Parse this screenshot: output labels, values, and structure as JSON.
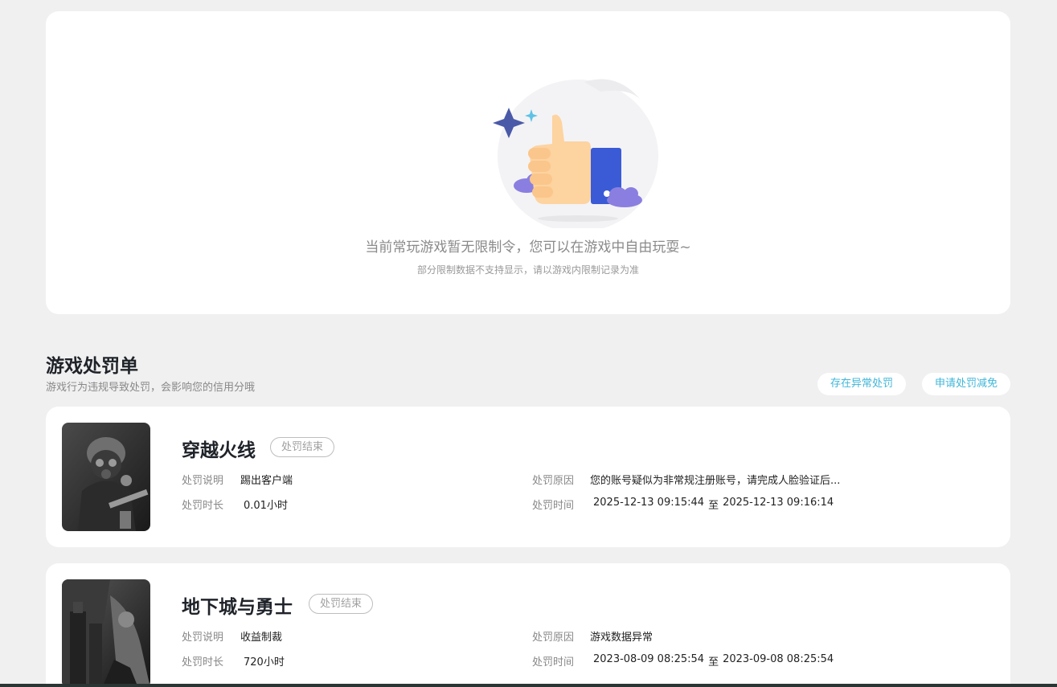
{
  "status": {
    "title": "当前常玩游戏暂无限制令，您可以在游戏中自由玩耍~",
    "note": "部分限制数据不支持显示，请以游戏内限制记录为准"
  },
  "section": {
    "title": "游戏处罚单",
    "subtitle": "游戏行为违规导致处罚，会影响您的信用分哦",
    "buttons": {
      "abnormal": "存在异常处罚",
      "reduce": "申请处罚减免"
    }
  },
  "labels": {
    "desc": "处罚说明",
    "duration": "处罚时长",
    "reason": "处罚原因",
    "time": "处罚时间",
    "to": "至"
  },
  "penalties": [
    {
      "game": "穿越火线",
      "status": "处罚结束",
      "desc": "踢出客户端",
      "duration": "0.01小时",
      "reason": "您的账号疑似为非常规注册账号，请完成人脸验证后...",
      "start": "2025-12-13 09:15:44",
      "end": "2025-12-13 09:16:14"
    },
    {
      "game": "地下城与勇士",
      "status": "处罚结束",
      "desc": "收益制裁",
      "duration": "720小时",
      "reason": "游戏数据异常",
      "start": "2023-08-09 08:25:54",
      "end": "2023-09-08 08:25:54"
    }
  ],
  "colors": {
    "accent": "#3fb6d9",
    "page_bg": "#f0f0f0",
    "card_bg": "#ffffff"
  }
}
